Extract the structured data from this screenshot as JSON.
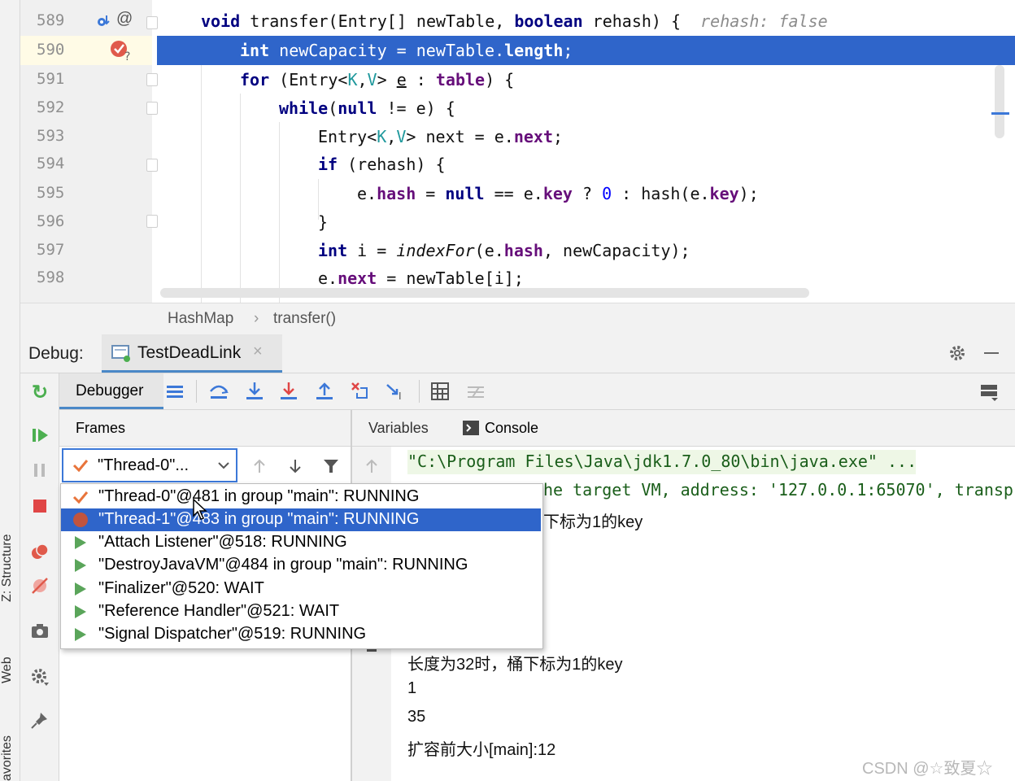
{
  "editor": {
    "lines": [
      {
        "num": "589",
        "text": "void transfer(Entry[] newTable, boolean rehash) {",
        "hint": "rehash: false"
      },
      {
        "num": "590",
        "text": "int newCapacity = newTable.length;"
      },
      {
        "num": "591",
        "text": "for (Entry<K,V> e : table) {"
      },
      {
        "num": "592",
        "text": "while(null != e) {"
      },
      {
        "num": "593",
        "text": "Entry<K,V> next = e.next;"
      },
      {
        "num": "594",
        "text": "if (rehash) {"
      },
      {
        "num": "595",
        "text": "e.hash = null == e.key ? 0 : hash(e.key);"
      },
      {
        "num": "596",
        "text": "}"
      },
      {
        "num": "597",
        "text": "int i = indexFor(e.hash, newCapacity);"
      },
      {
        "num": "598",
        "text": "e.next = newTable[i];"
      }
    ]
  },
  "breadcrumb": {
    "class_name": "HashMap",
    "method_name": "transfer()"
  },
  "debug": {
    "label": "Debug:",
    "session_tab": "TestDeadLink",
    "debugger_tab": "Debugger",
    "frames_label": "Frames",
    "variables_label": "Variables",
    "console_label": "Console",
    "selected_thread": "\"Thread-0\"..."
  },
  "threads": [
    {
      "label": "\"Thread-0\"@481 in group \"main\": RUNNING",
      "icon": "check-icon"
    },
    {
      "label": "\"Thread-1\"@483 in group \"main\": RUNNING",
      "icon": "breakpoint-icon"
    },
    {
      "label": "\"Attach Listener\"@518: RUNNING",
      "icon": "play-icon"
    },
    {
      "label": "\"DestroyJavaVM\"@484 in group \"main\": RUNNING",
      "icon": "play-icon"
    },
    {
      "label": "\"Finalizer\"@520: WAIT",
      "icon": "play-icon"
    },
    {
      "label": "\"Reference Handler\"@521: WAIT",
      "icon": "play-icon"
    },
    {
      "label": "\"Signal Dispatcher\"@519: RUNNING",
      "icon": "play-icon"
    }
  ],
  "console": {
    "lines": [
      "\"C:\\Program Files\\Java\\jdk1.7.0_80\\bin\\java.exe\" ...",
      "he target VM, address: '127.0.0.1:65070', transp",
      "下标为1的key",
      "长度为32时，桶下标为1的key",
      "1",
      "35",
      "扩容前大小[main]:12"
    ]
  },
  "left_strip": {
    "structure": "Z: Structure",
    "web": "Web",
    "favorites": "avorites"
  },
  "watermark": "CSDN @☆致夏☆",
  "colors": {
    "selection": "#2f65ca",
    "keyword": "#000080",
    "field": "#660e7a"
  }
}
